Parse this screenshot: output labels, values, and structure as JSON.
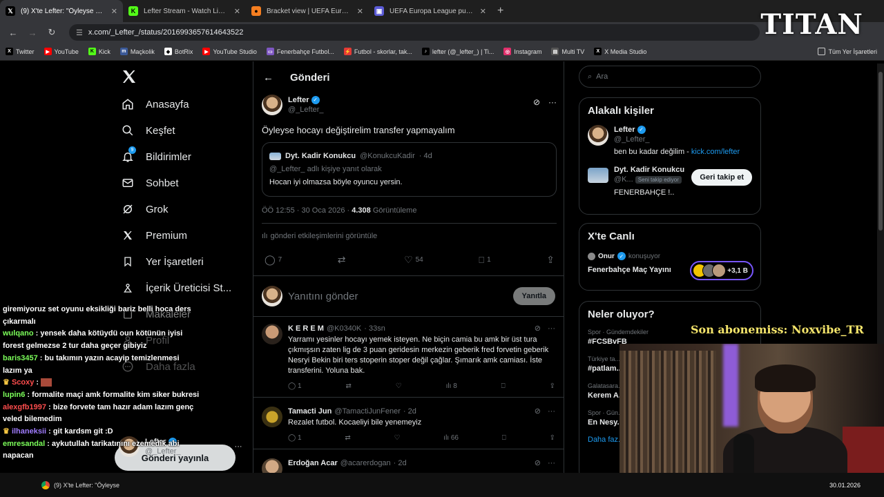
{
  "browser": {
    "tabs": [
      {
        "title": "(9) X'te Lefter: \"Öyleyse hocayı değiştirelim transfer yapmayalım\"",
        "icon": "x-favicon",
        "color": "#000000",
        "active": true
      },
      {
        "title": "Lefter Stream - Watch Live on Kick",
        "icon": "kick-favicon",
        "color": "#53fc18",
        "active": false
      },
      {
        "title": "Bracket view | UEFA Europa League",
        "icon": "uefa-favicon",
        "color": "#f57e20",
        "active": false
      },
      {
        "title": "UEFA Europa League puan tablosu",
        "icon": "generic-favicon",
        "color": "#5b5bd6",
        "active": false
      }
    ],
    "url": "x.com/_Lefter_/status/2016993657614643522",
    "bookmarks": [
      {
        "label": "Twitter",
        "icon": "x-icon",
        "color": "#000000"
      },
      {
        "label": "YouTube",
        "icon": "youtube-icon",
        "color": "#ff0000"
      },
      {
        "label": "Kick",
        "icon": "kick-icon",
        "color": "#53fc18"
      },
      {
        "label": "Maçkolik",
        "icon": "mackolik-icon",
        "color": "#3b5998"
      },
      {
        "label": "BotRix",
        "icon": "botrix-icon",
        "color": "#ffffff"
      },
      {
        "label": "YouTube Studio",
        "icon": "youtube-studio-icon",
        "color": "#ff0000"
      },
      {
        "label": "Fenerbahçe Futbol...",
        "icon": "tv-icon",
        "color": "#7e57c2"
      },
      {
        "label": "Futbol - skorlar, tak...",
        "icon": "flash-icon",
        "color": "#e53935"
      },
      {
        "label": "lefter (@_lefter_) | Ti...",
        "icon": "tiktok-icon",
        "color": "#000000"
      },
      {
        "label": "Instagram",
        "icon": "instagram-icon",
        "color": "#e1306c"
      },
      {
        "label": "Multi TV",
        "icon": "multitv-icon",
        "color": "#555555"
      },
      {
        "label": "X Media Studio",
        "icon": "x-icon",
        "color": "#000000"
      }
    ],
    "all_bookmarks": "Tüm Yer İşaretleri"
  },
  "nav": {
    "items": [
      {
        "label": "Anasayfa",
        "icon": "home-icon"
      },
      {
        "label": "Keşfet",
        "icon": "search-icon"
      },
      {
        "label": "Bildirimler",
        "icon": "bell-icon",
        "badge": "9"
      },
      {
        "label": "Sohbet",
        "icon": "mail-icon"
      },
      {
        "label": "Grok",
        "icon": "grok-icon"
      },
      {
        "label": "Premium",
        "icon": "x-icon"
      },
      {
        "label": "Yer İşaretleri",
        "icon": "bookmark-icon"
      },
      {
        "label": "İçerik Üreticisi St...",
        "icon": "creator-icon"
      },
      {
        "label": "Makaleler",
        "icon": "article-icon"
      },
      {
        "label": "Profil",
        "icon": "profile-icon"
      },
      {
        "label": "Daha fazla",
        "icon": "more-icon"
      }
    ],
    "post_button": "Gönderi yayınla",
    "account": {
      "name": "Lefter",
      "handle": "@_Lefter_"
    }
  },
  "header": {
    "title": "Gönderi"
  },
  "main_tweet": {
    "name": "Lefter",
    "handle": "@_Lefter_",
    "text": "Öyleyse hocayı değiştirelim transfer yapmayalım",
    "quote": {
      "name": "Dyt. Kadir Konukcu",
      "handle": "@KonukcuKadir",
      "time": "· 4d",
      "reply_to": "@_Lefter_ adlı kişiye yanıt olarak",
      "text": "Hocan iyi olmazsa böyle oyuncu yersin."
    },
    "time": "ÖÖ 12:55 · 30 Oca 2026 ·",
    "views": "4.308",
    "views_label": "Görüntüleme",
    "engagements": "gönderi etkileşimlerini görüntüle",
    "replies": "7",
    "retweets": "",
    "likes": "54",
    "bookmarks": "1"
  },
  "reply_box": {
    "placeholder": "Yanıtını gönder",
    "button": "Yanıtla"
  },
  "replies": [
    {
      "name": "K E R E M",
      "handle": "@K0340K",
      "time": "· 33sn",
      "text": "Yarramı yesinler hocayı yemek isteyen. Ne biçin camia bu amk bir üst tura çıkmışsın zaten lig de 3 puan geridesin merkezin geberik fred forvetin geberik Nesryi Bekin biri ters stoperin stoper değil çağlar. Şımarık amk camiası. İste transferini. Yoluna bak.",
      "replies": "1",
      "views": "8"
    },
    {
      "name": "Tamacti Jun",
      "handle": "@TamactiJunFener",
      "time": "· 2d",
      "text": "Rezalet futbol. Kocaeliyi bile yenemeyiz",
      "replies": "1",
      "views": "66"
    },
    {
      "name": "Erdoğan Acar",
      "handle": "@acarerdogan",
      "time": "· 2d",
      "text": "",
      "replies": "",
      "views": ""
    }
  ],
  "right": {
    "search_placeholder": "Ara",
    "related_title": "Alakalı kişiler",
    "related": [
      {
        "name": "Lefter",
        "handle": "@_Lefter_",
        "bio": "ben bu kadar değilim -",
        "link": "kick.com/lefter"
      },
      {
        "name": "Dyt. Kadir Konukcu",
        "handle": "@K...",
        "badge": "Seni takip ediyor",
        "bio": "FENERBAHÇE !..",
        "button": "Geri takip et"
      }
    ],
    "live_title": "X'te Canlı",
    "live": {
      "host": "Onur",
      "status": "konuşuyor",
      "title": "Fenerbahçe Maç Yayını",
      "count": "+3,1 B"
    },
    "trends_title": "Neler oluyor?",
    "trends": [
      {
        "context": "Spor · Gündemdekiler",
        "name": "#FCSBvFB"
      },
      {
        "context": "Türkiye ta...",
        "name": "#patlam..."
      },
      {
        "context": "Galatasara...",
        "name": "Kerem A..."
      },
      {
        "context": "Spor · Gün...",
        "name": "En Nesy..."
      }
    ],
    "show_more": "Daha faz..."
  },
  "chat": [
    {
      "user": "",
      "color": "#ffffff",
      "msg": "giremiyoruz set oyunu eksikliği bariz belli hoca ders çıkarmalı"
    },
    {
      "user": "wulqano",
      "color": "#7cff5a",
      "msg": "yensek daha kötüydü oun kötünün iyisi forest gelmezse 2 tur daha geçer gibiyiz"
    },
    {
      "user": "baris3457",
      "color": "#7cff5a",
      "msg": "bu takımın yazın acayip temizlenmesi lazım ya"
    },
    {
      "user": "Scoxy",
      "color": "#ff4d4d",
      "msg": ""
    },
    {
      "user": "lupin6",
      "color": "#7cff5a",
      "msg": "formalite maçi amk formalite kim siker bukresi"
    },
    {
      "user": "alexgfb1997",
      "color": "#ff4d4d",
      "msg": "bize forvete tam hazır adam lazım genç veled bilemedim"
    },
    {
      "user": "ilhaneksii",
      "color": "#a07cff",
      "msg": "git kardsm git :D"
    },
    {
      "user": "emresandal",
      "color": "#7cff5a",
      "msg": "aykutullah tarikatınını ezemedik abi napacan"
    }
  ],
  "overlays": {
    "brand": "TITAN",
    "sub_alert": "Son abonemiss: Noxvibe_TR",
    "taskbar_item": "(9) X'te Lefter: \"Öyleyse",
    "date": "30.01.2026"
  }
}
